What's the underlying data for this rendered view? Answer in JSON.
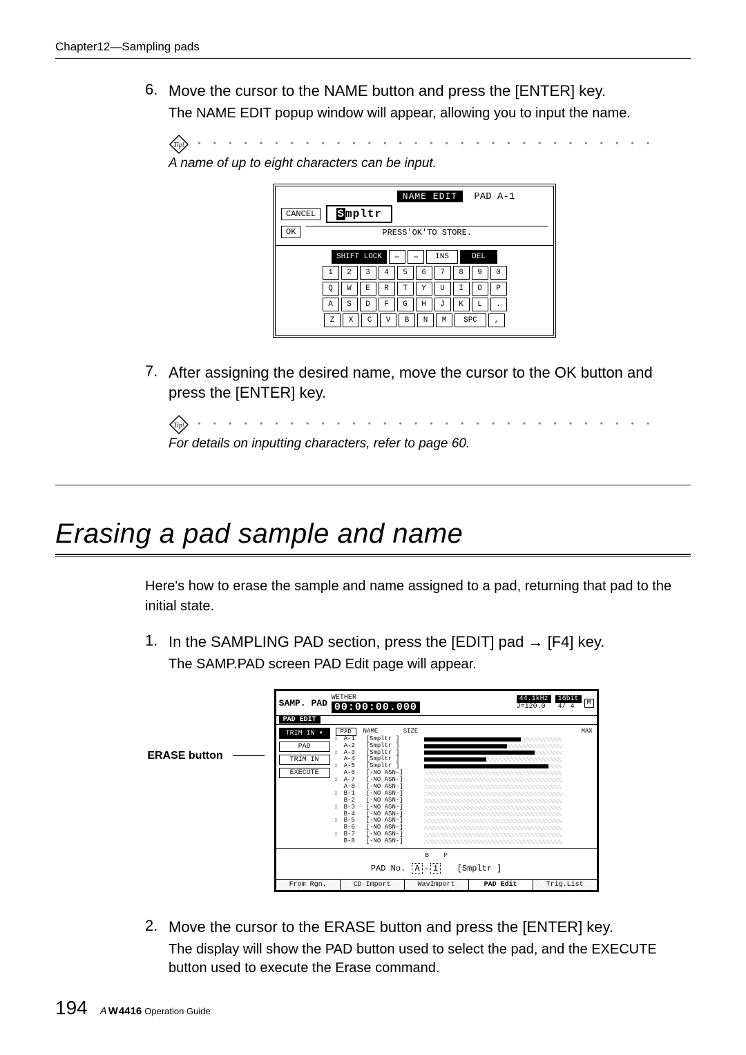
{
  "header": {
    "chapter": "Chapter12—Sampling pads"
  },
  "step6": {
    "num": "6.",
    "title": "Move the cursor to the NAME button and press the [ENTER] key.",
    "sub": "The NAME EDIT popup window will appear, allowing you to input the name.",
    "tip": "A name of up to eight characters can be input."
  },
  "nameEdit": {
    "title": "NAME EDIT",
    "padId": "PAD A-1",
    "cancel": "CANCEL",
    "ok": "OK",
    "inputHead": "S",
    "inputRest": "mpltr",
    "press": "PRESS'OK'TO STORE.",
    "shiftLock": "SHIFT LOCK",
    "ins": "INS",
    "del": "DEL",
    "row1": [
      "1",
      "2",
      "3",
      "4",
      "5",
      "6",
      "7",
      "8",
      "9",
      "0"
    ],
    "row2": [
      "Q",
      "W",
      "E",
      "R",
      "T",
      "Y",
      "U",
      "I",
      "O",
      "P"
    ],
    "row3": [
      "A",
      "S",
      "D",
      "F",
      "G",
      "H",
      "J",
      "K",
      "L",
      "."
    ],
    "row4": [
      "Z",
      "X",
      "C",
      "V",
      "B",
      "N",
      "M"
    ],
    "spc": "SPC"
  },
  "step7": {
    "num": "7.",
    "title": "After assigning the desired name, move the cursor to the OK button and press the [ENTER] key.",
    "tip": "For details on inputting characters, refer to page 60."
  },
  "section": {
    "title": "Erasing a pad sample and name",
    "intro": "Here's how to erase the sample and name assigned to a pad, returning that pad to the initial state."
  },
  "step1": {
    "num": "1.",
    "title": "In the SAMPLING PAD section, press the [EDIT] pad → [F4] key.",
    "sub": "The SAMP.PAD screen PAD Edit page will appear."
  },
  "eraseLabel": "ERASE button",
  "samp": {
    "title": "SAMP. PAD",
    "song": "WETHER",
    "time": "00:00:00.000",
    "rate": "44.1kHz",
    "bits": "16bit",
    "tempo": "J=120.0",
    "bars": "4/ 4",
    "m": "M",
    "padEdit": "PAD EDIT",
    "btns": {
      "trimIn": "TRIM IN ▾",
      "pad": "PAD",
      "trimIn2": "TRIM IN",
      "execute": "EXECUTE"
    },
    "cols": {
      "pad": "PAD",
      "name": "NAME",
      "size": "SIZE",
      "max": "MAX"
    },
    "rows": [
      {
        "loop": "↕",
        "id": "A-1",
        "name": "[Smpltr  ]",
        "bar": 70
      },
      {
        "loop": "",
        "id": "A-2",
        "name": "[Smpltr  ]",
        "bar": 60
      },
      {
        "loop": "↕",
        "id": "A-3",
        "name": "[Smpltr  ]",
        "bar": 80
      },
      {
        "loop": "",
        "id": "A-4",
        "name": "[Smpltr  ]",
        "bar": 45
      },
      {
        "loop": "↕",
        "id": "A-5",
        "name": "[Smpltr  ]",
        "bar": 90
      },
      {
        "loop": "",
        "id": "A-6",
        "name": "[-NO ASN-]",
        "bar": 0
      },
      {
        "loop": "↕",
        "id": "A-7",
        "name": "[-NO ASN-]",
        "bar": 0
      },
      {
        "loop": "",
        "id": "A-8",
        "name": "[-NO ASN-]",
        "bar": 0
      },
      {
        "loop": "↕",
        "id": "B-1",
        "name": "[-NO ASN-]",
        "bar": 0
      },
      {
        "loop": "",
        "id": "B-2",
        "name": "[-NO ASN-]",
        "bar": 0
      },
      {
        "loop": "↕",
        "id": "B-3",
        "name": "[-NO ASN-]",
        "bar": 0
      },
      {
        "loop": "",
        "id": "B-4",
        "name": "[-NO ASN-]",
        "bar": 0
      },
      {
        "loop": "↕",
        "id": "B-5",
        "name": "[-NO ASN-]",
        "bar": 0
      },
      {
        "loop": "",
        "id": "B-6",
        "name": "[-NO ASN-]",
        "bar": 0
      },
      {
        "loop": "↕",
        "id": "B-7",
        "name": "[-NO ASN-]",
        "bar": 0
      },
      {
        "loop": "",
        "id": "B-8",
        "name": "[-NO ASN-]",
        "bar": 0
      }
    ],
    "padNoLabelB": "B",
    "padNoLabelP": "P",
    "padNoPrefix": "PAD No.",
    "padNoBank": "A",
    "padNoNum": "1",
    "padNoName": "[Smpltr  ]",
    "tabs": [
      "From Rgn.",
      "CD Import",
      "WavImport",
      "PAD Edit",
      "Trig.List"
    ]
  },
  "step2": {
    "num": "2.",
    "title": "Move the cursor to the ERASE button and press the [ENTER] key.",
    "sub": "The display will show the PAD button used to select the pad, and the EXECUTE button used to execute the Erase command."
  },
  "footer": {
    "page": "194",
    "model": "AW4416",
    "guide": "Operation Guide"
  }
}
